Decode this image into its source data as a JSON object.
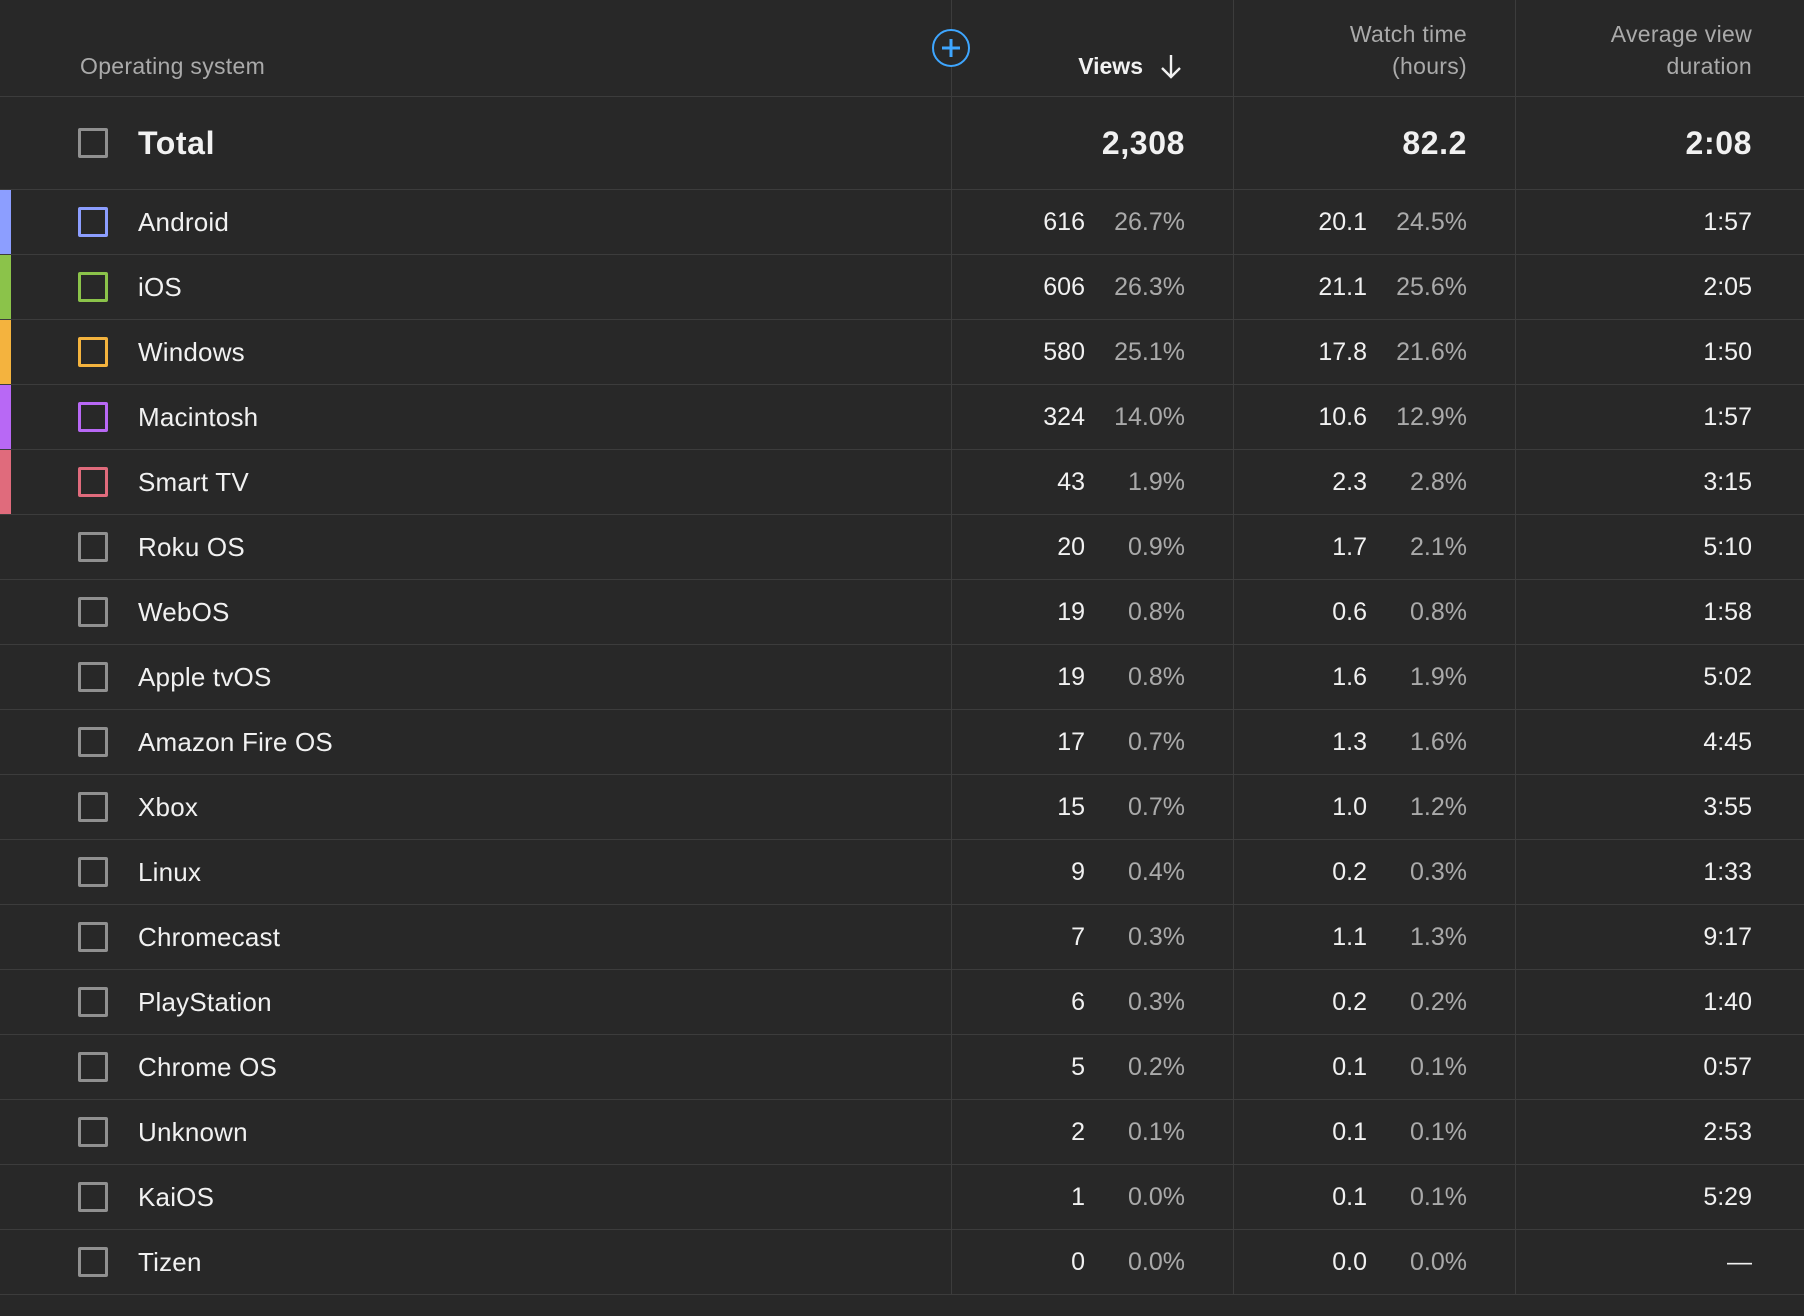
{
  "header": {
    "col_name": "Operating system",
    "col_views": "Views",
    "col_watch_1": "Watch time",
    "col_watch_2": "(hours)",
    "col_avg_1": "Average view",
    "col_avg_2": "duration",
    "sort_icon": "arrow-down-icon",
    "add_icon": "add-circle-icon"
  },
  "total": {
    "label": "Total",
    "views": "2,308",
    "watch": "82.2",
    "avg": "2:08"
  },
  "rows": [
    {
      "name": "Android",
      "views": "616",
      "views_pct": "26.7%",
      "watch": "20.1",
      "watch_pct": "24.5%",
      "avg": "1:57",
      "color": "#8c9eff"
    },
    {
      "name": "iOS",
      "views": "606",
      "views_pct": "26.3%",
      "watch": "21.1",
      "watch_pct": "25.6%",
      "avg": "2:05",
      "color": "#8bc34a"
    },
    {
      "name": "Windows",
      "views": "580",
      "views_pct": "25.1%",
      "watch": "17.8",
      "watch_pct": "21.6%",
      "avg": "1:50",
      "color": "#f4b33e"
    },
    {
      "name": "Macintosh",
      "views": "324",
      "views_pct": "14.0%",
      "watch": "10.6",
      "watch_pct": "12.9%",
      "avg": "1:57",
      "color": "#b868f5"
    },
    {
      "name": "Smart TV",
      "views": "43",
      "views_pct": "1.9%",
      "watch": "2.3",
      "watch_pct": "2.8%",
      "avg": "3:15",
      "color": "#e06b7c"
    },
    {
      "name": "Roku OS",
      "views": "20",
      "views_pct": "0.9%",
      "watch": "1.7",
      "watch_pct": "2.1%",
      "avg": "5:10",
      "color": ""
    },
    {
      "name": "WebOS",
      "views": "19",
      "views_pct": "0.8%",
      "watch": "0.6",
      "watch_pct": "0.8%",
      "avg": "1:58",
      "color": ""
    },
    {
      "name": "Apple tvOS",
      "views": "19",
      "views_pct": "0.8%",
      "watch": "1.6",
      "watch_pct": "1.9%",
      "avg": "5:02",
      "color": ""
    },
    {
      "name": "Amazon Fire OS",
      "views": "17",
      "views_pct": "0.7%",
      "watch": "1.3",
      "watch_pct": "1.6%",
      "avg": "4:45",
      "color": ""
    },
    {
      "name": "Xbox",
      "views": "15",
      "views_pct": "0.7%",
      "watch": "1.0",
      "watch_pct": "1.2%",
      "avg": "3:55",
      "color": ""
    },
    {
      "name": "Linux",
      "views": "9",
      "views_pct": "0.4%",
      "watch": "0.2",
      "watch_pct": "0.3%",
      "avg": "1:33",
      "color": ""
    },
    {
      "name": "Chromecast",
      "views": "7",
      "views_pct": "0.3%",
      "watch": "1.1",
      "watch_pct": "1.3%",
      "avg": "9:17",
      "color": ""
    },
    {
      "name": "PlayStation",
      "views": "6",
      "views_pct": "0.3%",
      "watch": "0.2",
      "watch_pct": "0.2%",
      "avg": "1:40",
      "color": ""
    },
    {
      "name": "Chrome OS",
      "views": "5",
      "views_pct": "0.2%",
      "watch": "0.1",
      "watch_pct": "0.1%",
      "avg": "0:57",
      "color": ""
    },
    {
      "name": "Unknown",
      "views": "2",
      "views_pct": "0.1%",
      "watch": "0.1",
      "watch_pct": "0.1%",
      "avg": "2:53",
      "color": ""
    },
    {
      "name": "KaiOS",
      "views": "1",
      "views_pct": "0.0%",
      "watch": "0.1",
      "watch_pct": "0.1%",
      "avg": "5:29",
      "color": ""
    },
    {
      "name": "Tizen",
      "views": "0",
      "views_pct": "0.0%",
      "watch": "0.0",
      "watch_pct": "0.0%",
      "avg": "—",
      "color": ""
    }
  ]
}
